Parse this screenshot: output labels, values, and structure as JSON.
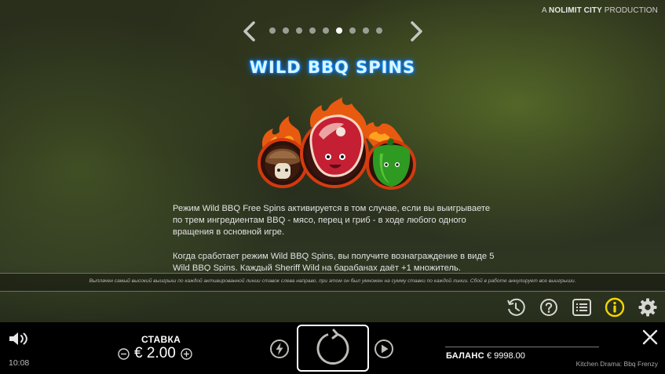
{
  "brand": {
    "prefix": "A",
    "name": "NOLIMIT CITY",
    "suffix": "PRODUCTION"
  },
  "pager": {
    "total_pages": 9,
    "active_index": 5
  },
  "title": "WILD BBQ SPINS",
  "description": [
    "Режим Wild BBQ Free Spins активируется в том случае, если вы выигрываете по трем ингредиентам BBQ - мясо, перец и гриб - в ходе любого одного вращения в основной игре.",
    "Когда сработает режим Wild BBQ Spins, вы получите вознаграждение в виде 5 Wild BBQ Spins. Каждый Sheriff Wild на барабанах даёт +1 множитель."
  ],
  "info_note": "Выплачен самый высокий выигрыш по каждой активированной линии ставок слева направо, при этом он был умножен на сумму ставки по каждой линии. Сбой в работе аннулирует все выигрыши.",
  "toolbar": {
    "icons": [
      "history-icon",
      "help-icon",
      "paytable-icon",
      "info-icon",
      "settings-icon"
    ],
    "active": "info-icon",
    "accent": "#f2d600"
  },
  "bottom": {
    "time": "10:08",
    "bet_label": "СТАВКА",
    "bet_value": "€ 2.00",
    "balance_label": "БАЛАНС",
    "balance_value": "€ 9998.00",
    "game_name": "Kitchen Drama: Bbq Frenzy"
  }
}
